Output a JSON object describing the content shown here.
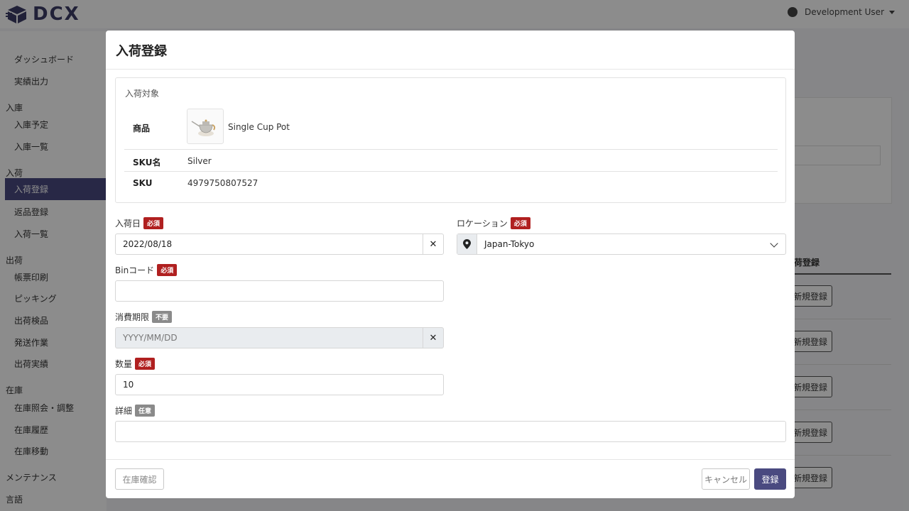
{
  "header": {
    "brand": "DCX",
    "user_name": "Development User"
  },
  "sidebar": {
    "items": [
      {
        "label": "ダッシュボード"
      },
      {
        "label": "実績出力"
      }
    ],
    "sections": [
      {
        "title": "入庫",
        "items": [
          "入庫予定",
          "入庫一覧"
        ]
      },
      {
        "title": "入荷",
        "items": [
          "入荷登録",
          "返品登録",
          "入荷一覧"
        ]
      },
      {
        "title": "出荷",
        "items": [
          "帳票印刷",
          "ピッキング",
          "出荷検品",
          "発送作業",
          "出荷実績"
        ]
      },
      {
        "title": "在庫",
        "items": [
          "在庫照会・調整",
          "在庫履歴",
          "在庫移動"
        ]
      },
      {
        "title": "メンテナンス",
        "items": []
      },
      {
        "title": "言語",
        "items": []
      }
    ]
  },
  "background": {
    "column_header": "荷登録",
    "row_button": "新規登録"
  },
  "modal": {
    "title": "入荷登録",
    "target": {
      "label": "入荷対象",
      "product_label": "商品",
      "product_name": "Single Cup Pot",
      "sku_name_label": "SKU名",
      "sku_name": "Silver",
      "sku_label": "SKU",
      "sku": "4979750807527"
    },
    "fields": {
      "date": {
        "label": "入荷日",
        "badge": "必須",
        "value": "2022/08/18"
      },
      "location": {
        "label": "ロケーション",
        "badge": "必須",
        "value": "Japan-Tokyo"
      },
      "bin": {
        "label": "Binコード",
        "badge": "必須",
        "value": ""
      },
      "expiry": {
        "label": "消費期限",
        "badge": "不要",
        "placeholder": "YYYY/MM/DD"
      },
      "quantity": {
        "label": "数量",
        "badge": "必須",
        "value": "10"
      },
      "detail": {
        "label": "詳細",
        "badge": "任意",
        "value": ""
      }
    },
    "buttons": {
      "stock_check": "在庫確認",
      "cancel": "キャンセル",
      "submit": "登録"
    }
  },
  "colors": {
    "primary": "#4a4a80",
    "required_badge": "#b02020",
    "optional_badge": "#8a8a8a"
  }
}
